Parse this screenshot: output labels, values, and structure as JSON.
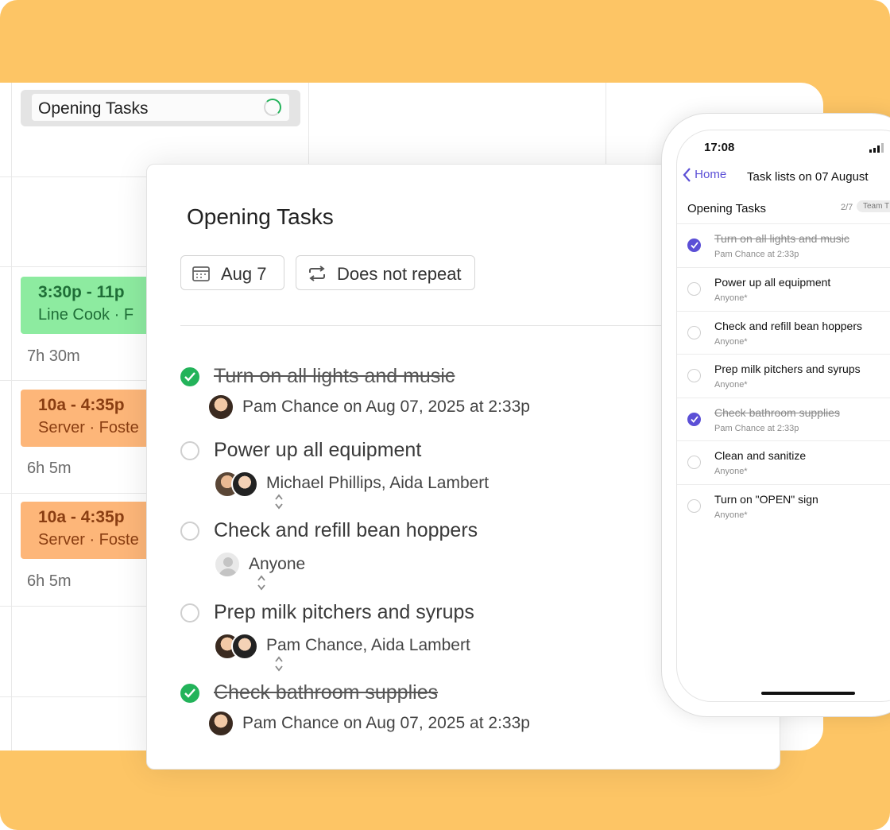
{
  "colors": {
    "background": "#FDC565",
    "task_done": "#23b35a",
    "phone_accent": "#5b4fd6",
    "shift_green": "#8DEBA0",
    "shift_orange": "#FDB679"
  },
  "schedule": {
    "task_pill": {
      "label": "Opening Tasks",
      "icon": "progress-ring-icon"
    },
    "shifts": [
      {
        "time": "3:30p - 11p",
        "role": "Line Cook · F",
        "duration": "7h 30m",
        "color": "green"
      },
      {
        "time": "10a - 4:35p",
        "role": "Server · Foste",
        "duration": "6h 5m",
        "color": "orange"
      },
      {
        "time": "10a - 4:35p",
        "role": "Server · Foste",
        "duration": "6h 5m",
        "color": "orange"
      }
    ]
  },
  "modal": {
    "title": "Opening Tasks",
    "date_chip": {
      "icon": "calendar-icon",
      "label": "Aug 7"
    },
    "repeat_chip": {
      "icon": "repeat-icon",
      "label": "Does not repeat"
    },
    "tasks": [
      {
        "title": "Turn on all lights and music",
        "done": true,
        "assignee": "Pam Chance on Aug 07, 2025 at 2:33p"
      },
      {
        "title": "Power up all equipment",
        "done": false,
        "assignee": "Michael Phillips, Aida Lambert"
      },
      {
        "title": "Check and refill bean hoppers",
        "done": false,
        "assignee": "Anyone"
      },
      {
        "title": "Prep milk pitchers and syrups",
        "done": false,
        "assignee": "Pam Chance, Aida Lambert"
      },
      {
        "title": "Check bathroom supplies",
        "done": true,
        "assignee": "Pam Chance on Aug 07, 2025 at 2:33p"
      }
    ]
  },
  "phone": {
    "status_time": "17:08",
    "back_label": "Home",
    "nav_title": "Task lists on 07 August",
    "list_title": "Opening Tasks",
    "count": "2/7",
    "badge": "Team T",
    "tasks": [
      {
        "title": "Turn on all lights and music",
        "sub": "Pam Chance at 2:33p",
        "done": true
      },
      {
        "title": "Power up all equipment",
        "sub": "Anyone*",
        "done": false
      },
      {
        "title": "Check and refill bean hoppers",
        "sub": "Anyone*",
        "done": false
      },
      {
        "title": "Prep milk pitchers and syrups",
        "sub": "Anyone*",
        "done": false
      },
      {
        "title": "Check bathroom supplies",
        "sub": "Pam Chance at 2:33p",
        "done": true
      },
      {
        "title": "Clean and sanitize",
        "sub": "Anyone*",
        "done": false
      },
      {
        "title": "Turn on \"OPEN\" sign",
        "sub": "Anyone*",
        "done": false
      }
    ]
  }
}
